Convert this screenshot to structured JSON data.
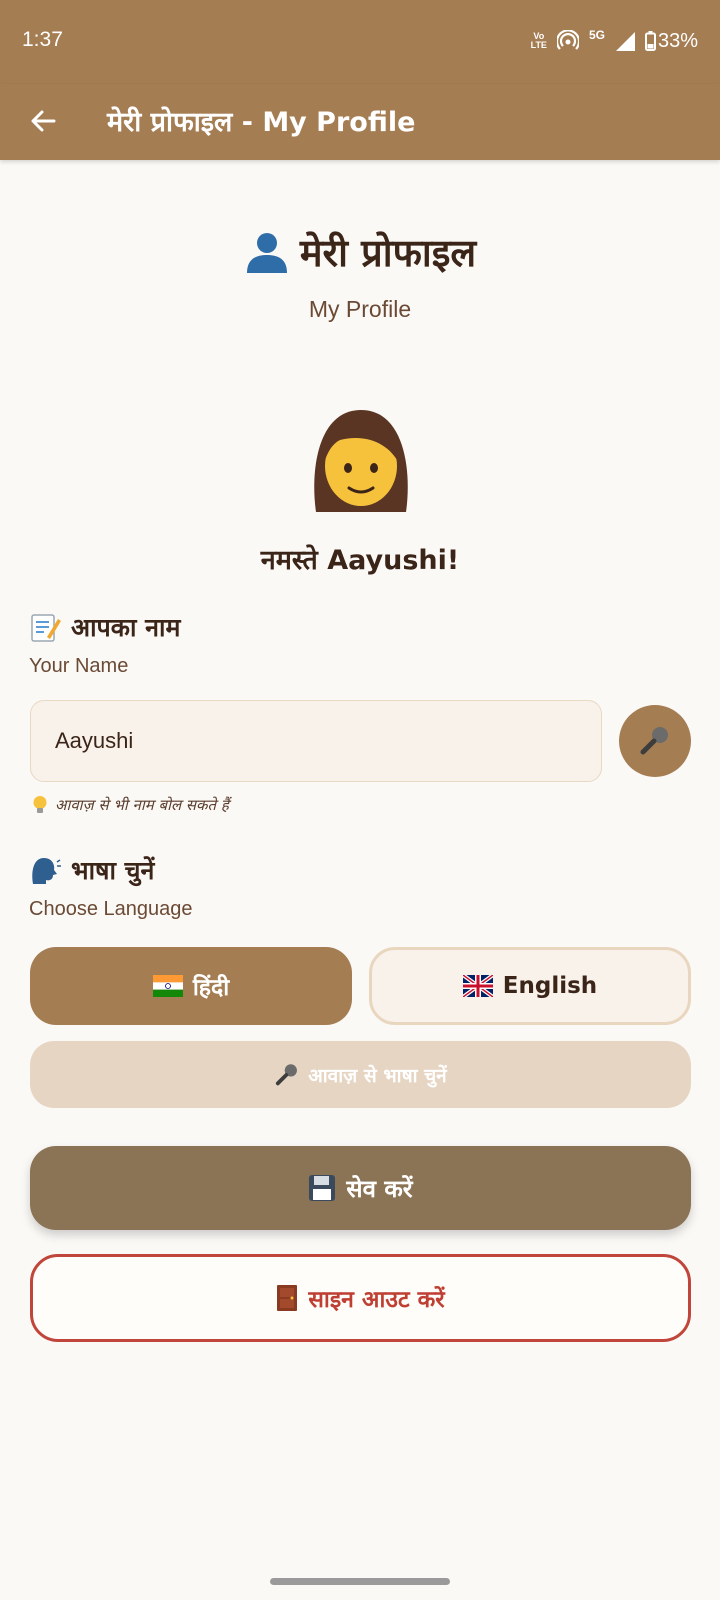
{
  "status_bar": {
    "time": "1:37",
    "volte_line1": "Vo",
    "volte_line2": "LTE",
    "network": "5G",
    "battery": "33%"
  },
  "app_bar": {
    "title": "मेरी प्रोफाइल - My Profile",
    "back_icon": "arrow-left-icon"
  },
  "header": {
    "icon": "person-icon",
    "title": "मेरी प्रोफाइल",
    "subtitle": "My Profile"
  },
  "avatar": {
    "icon": "woman-emoji-icon",
    "greeting": "नमस्ते Aayushi!"
  },
  "name_section": {
    "icon": "memo-icon",
    "title": "आपका नाम",
    "subtitle": "Your Name",
    "input_value": "Aayushi",
    "mic_icon": "microphone-icon",
    "hint_icon": "lightbulb-icon",
    "hint": "आवाज़ से भी नाम बोल सकते हैं"
  },
  "language_section": {
    "icon": "speaking-head-icon",
    "title": "भाषा चुनें",
    "subtitle": "Choose Language",
    "options": [
      {
        "flag": "india-flag-icon",
        "label": "हिंदी",
        "selected": true
      },
      {
        "flag": "uk-flag-icon",
        "label": "English",
        "selected": false
      }
    ],
    "voice_button_label": "आवाज़ से भाषा चुनें"
  },
  "actions": {
    "save_label": "सेव करें",
    "save_icon": "floppy-disk-icon",
    "signout_label": "साइन आउट करें",
    "signout_icon": "door-icon"
  },
  "colors": {
    "primary": "#a57d53",
    "save": "#8b7355",
    "danger": "#c0463b",
    "background": "#fbf9f6"
  }
}
